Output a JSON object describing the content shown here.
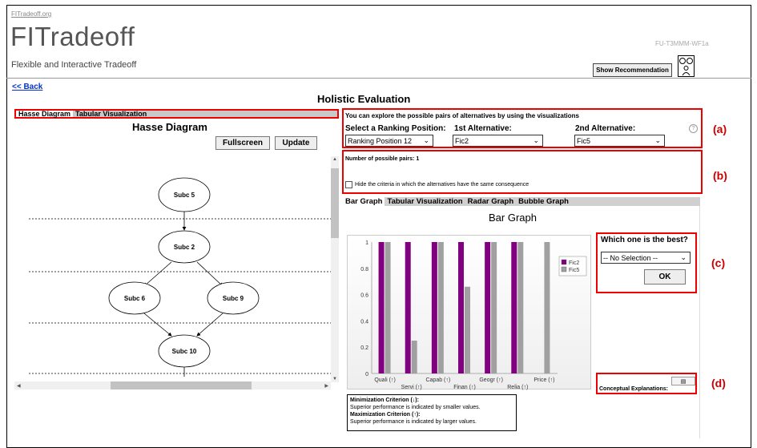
{
  "header": {
    "site_link": "FITradeoff.org",
    "logo": "FITradeoff",
    "tagline": "Flexible and Interactive Tradeoff",
    "code": "FU-T3MMM-WF1a",
    "show_recommendation": "Show Recommendation"
  },
  "nav": {
    "back": "<< Back"
  },
  "page_title": "Holistic Evaluation",
  "left_panel": {
    "tabs": [
      "Hasse Diagram",
      "Tabular Visualization"
    ],
    "title": "Hasse Diagram",
    "fullscreen": "Fullscreen",
    "update": "Update",
    "nodes": [
      "Subc 5",
      "Subc 2",
      "Subc 6",
      "Subc 9",
      "Subc 10"
    ]
  },
  "panel_a": {
    "title": "You can explore the possible pairs of alternatives by using the visualizations",
    "ranking_label": "Select a Ranking Position:",
    "ranking_value": "Ranking Position 12",
    "alt1_label": "1st Alternative:",
    "alt1_value": "Fic2",
    "alt2_label": "2nd Alternative:",
    "alt2_value": "Fic5",
    "help": "?"
  },
  "panel_b": {
    "pairs_label": "Number of possible pairs:",
    "pairs_value": "1",
    "hide_label": "Hide the criteria in which the alternatives have the same consequence"
  },
  "right_tabs": [
    "Bar Graph",
    "Tabular Visualization",
    "Radar Graph",
    "Bubble Graph"
  ],
  "bar_graph_title": "Bar Graph",
  "chart_data": {
    "type": "bar",
    "categories": [
      "Quali (↑)",
      "Servi (↑)",
      "Capab (↑)",
      "Finan (↑)",
      "Geogr (↑)",
      "Relia (↑)",
      "Price (↑)"
    ],
    "series": [
      {
        "name": "Fic2",
        "color": "#800080",
        "values": [
          1,
          1,
          1,
          1,
          1,
          1,
          0
        ]
      },
      {
        "name": "Fic5",
        "color": "#a0a0a0",
        "values": [
          1,
          0.25,
          1,
          0.66,
          1,
          1,
          1
        ]
      }
    ],
    "ylim": [
      0,
      1
    ],
    "yticks": [
      "0",
      "0.2",
      "0.4",
      "0.6",
      "0.8",
      "1"
    ]
  },
  "panel_c": {
    "label": "Which one is the best?",
    "select_value": "-- No Selection --",
    "ok": "OK"
  },
  "panel_d": {
    "label": "Conceptual Explanations:"
  },
  "side_labels": {
    "a": "(a)",
    "b": "(b)",
    "c": "(c)",
    "d": "(d)"
  },
  "criteria_legend": {
    "min_title": "Minimization Criterion (↓):",
    "min_text": "Superior performance is indicated by smaller values.",
    "max_title": "Maximization Criterion (↑):",
    "max_text": "Superior performance is indicated by larger values."
  }
}
